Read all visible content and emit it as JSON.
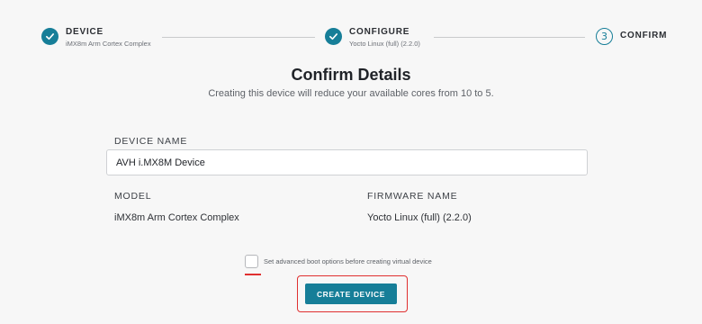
{
  "stepper": {
    "steps": [
      {
        "title": "DEVICE",
        "subtitle": "iMX8m Arm Cortex Complex",
        "state": "complete"
      },
      {
        "title": "CONFIGURE",
        "subtitle": "Yocto Linux (full) (2.2.0)",
        "state": "complete"
      },
      {
        "title": "CONFIRM",
        "number": "3",
        "state": "current"
      }
    ]
  },
  "header": {
    "title": "Confirm Details",
    "subtitle": "Creating this device will reduce your available cores from 10 to 5."
  },
  "form": {
    "device_name_label": "DEVICE NAME",
    "device_name_value": "AVH i.MX8M Device",
    "model_label": "MODEL",
    "model_value": "iMX8m Arm Cortex Complex",
    "firmware_label": "FIRMWARE NAME",
    "firmware_value": "Yocto Linux (full) (2.2.0)",
    "advanced_boot_label": "Set advanced boot options before creating virtual device"
  },
  "actions": {
    "create_label": "CREATE DEVICE"
  },
  "colors": {
    "accent": "#167e98",
    "highlight": "#e03030"
  }
}
